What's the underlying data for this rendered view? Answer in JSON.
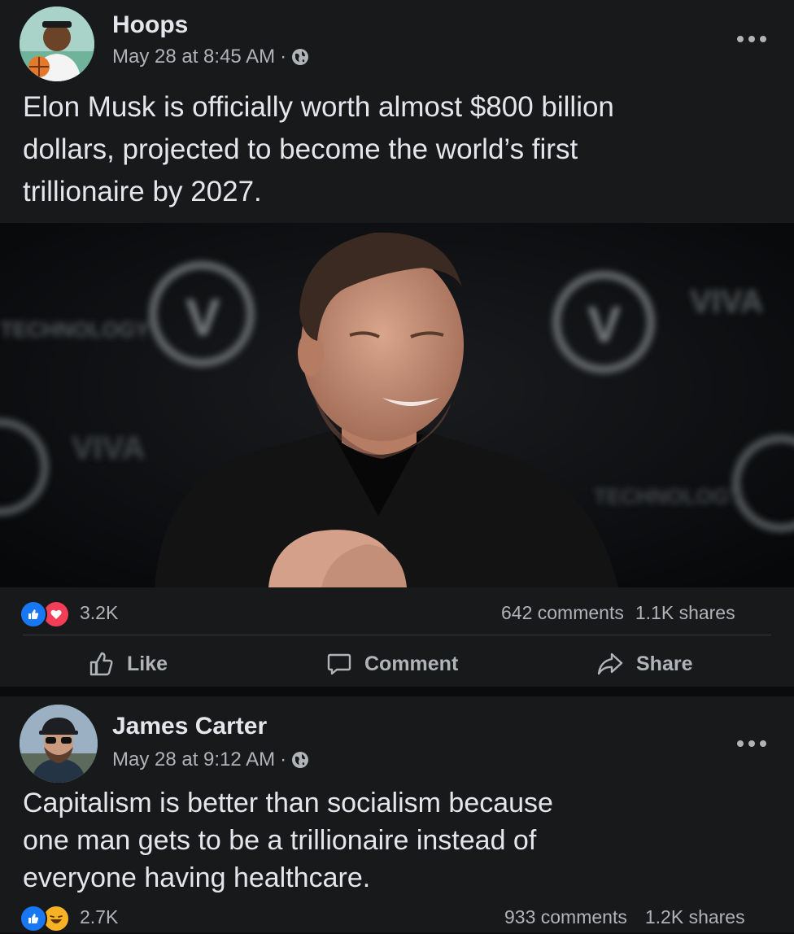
{
  "posts": [
    {
      "author": "Hoops",
      "timestamp": "May 28 at 8:45 AM",
      "meta_sep": "·",
      "privacy_icon": "globe-icon",
      "text": "Elon Musk is officially worth almost $800 billion\ndollars, projected to become the world’s first\ntrillionaire by 2027.",
      "reactions": [
        "like",
        "love"
      ],
      "reaction_count": "3.2K",
      "comments": "642 comments",
      "shares": "1.1K shares",
      "actions": {
        "like": "Like",
        "comment": "Comment",
        "share": "Share"
      },
      "photo_backdrop_text": [
        "VIVA",
        "TECHNOLOGY"
      ]
    },
    {
      "author": "James Carter",
      "timestamp": "May 28 at 9:12 AM",
      "meta_sep": "·",
      "privacy_icon": "globe-icon",
      "text": "Capitalism is better than socialism because\none man gets to be a trillionaire instead of\neveryone having healthcare.",
      "reactions": [
        "like",
        "haha"
      ],
      "reaction_count": "2.7K",
      "comments": "933 comments",
      "shares": "1.2K shares"
    }
  ],
  "colors": {
    "background": "#0e0e10",
    "card": "#18191b",
    "text_primary": "#e4e6eb",
    "text_secondary": "#b0b3b8",
    "like_blue": "#1877f2",
    "love_red": "#f33e58",
    "haha_yellow": "#f7b125"
  }
}
